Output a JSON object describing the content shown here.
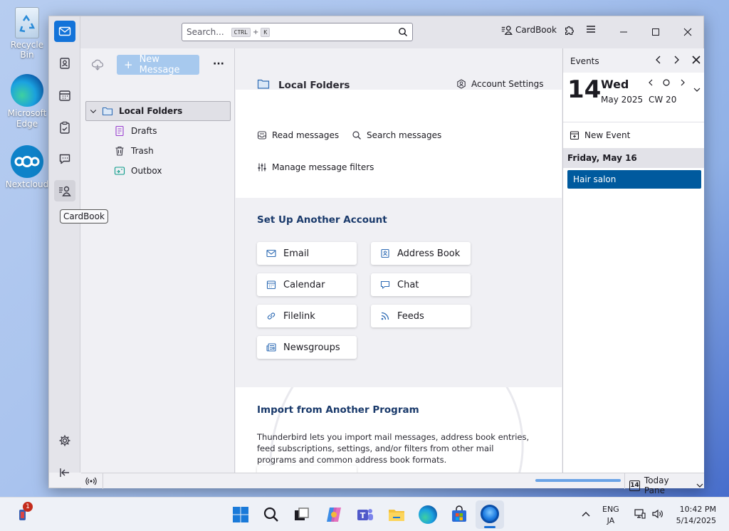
{
  "desktop": {
    "icons": [
      {
        "label": "Recycle Bin"
      },
      {
        "label": "Microsoft Edge"
      },
      {
        "label": "Nextcloud"
      }
    ]
  },
  "titlebar": {
    "search_placeholder": "Search...",
    "shortcut_key1": "CTRL",
    "shortcut_plus": "+",
    "shortcut_key2": "K",
    "cardbook_label": "CardBook"
  },
  "tooltip": {
    "text": "CardBook"
  },
  "folder_pane": {
    "new_message_label": "New Message",
    "more_label": "···",
    "folders": [
      {
        "label": "Local Folders",
        "selected": true
      },
      {
        "label": "Drafts"
      },
      {
        "label": "Trash"
      },
      {
        "label": "Outbox"
      }
    ]
  },
  "main": {
    "title": "Local Folders",
    "account_settings": "Account Settings",
    "actions": {
      "read": "Read messages",
      "search": "Search messages",
      "filters": "Manage message filters"
    },
    "setup_heading": "Set Up Another Account",
    "setup_buttons": [
      {
        "label": "Email",
        "icon": "mail-icon"
      },
      {
        "label": "Address Book",
        "icon": "address-book-icon"
      },
      {
        "label": "Calendar",
        "icon": "calendar-icon"
      },
      {
        "label": "Chat",
        "icon": "chat-icon"
      },
      {
        "label": "Filelink",
        "icon": "link-icon"
      },
      {
        "label": "Feeds",
        "icon": "rss-icon"
      },
      {
        "label": "Newsgroups",
        "icon": "newsgroup-icon"
      }
    ],
    "import_heading": "Import from Another Program",
    "import_text": "Thunderbird lets you import mail messages, address book entries, feed subscriptions, settings, and/or filters from other mail programs and common address book formats."
  },
  "today_pane": {
    "title": "Events",
    "day_number": "14",
    "weekday": "Wed",
    "month_year": "May 2025",
    "week": "CW 20",
    "new_event": "New Event",
    "date_header": "Friday, May 16",
    "event": "Hair salon",
    "event_color": "#005a9e",
    "toggle_label": "Today Pane",
    "toggle_day": "14"
  },
  "taskbar": {
    "badge": "1",
    "lang_top": "ENG",
    "lang_bottom": "JA",
    "time": "10:42 PM",
    "date": "5/14/2025"
  }
}
